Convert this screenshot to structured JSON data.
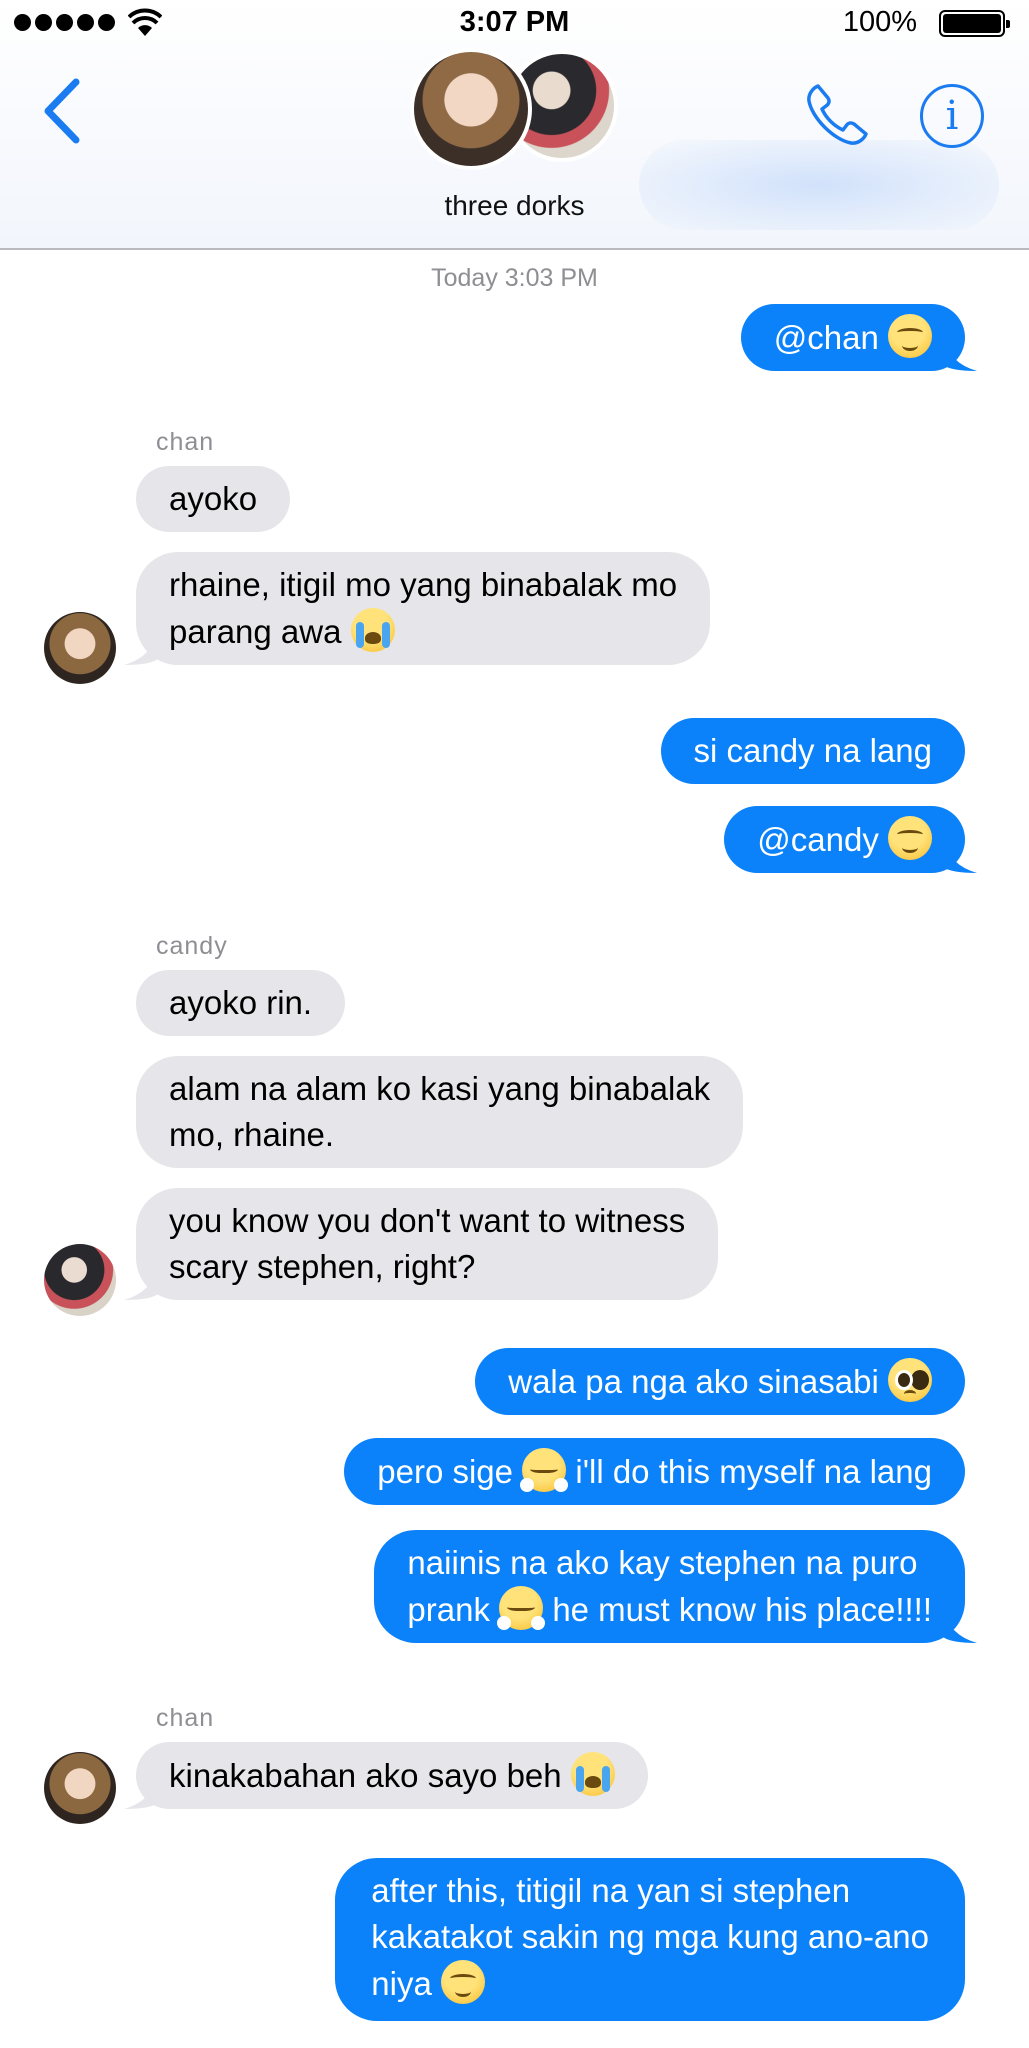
{
  "status_bar": {
    "time": "3:07 PM",
    "battery_percent": "100%",
    "signal_bars": 5,
    "wifi_icon": "wifi-icon",
    "battery_icon": "battery-icon"
  },
  "header": {
    "group_name": "three dorks",
    "back_icon": "chevron-left-icon",
    "call_icon": "phone-icon",
    "info_icon": "info-icon",
    "info_glyph": "i",
    "accent_color": "#1a7cf0"
  },
  "colors": {
    "outgoing_bubble": "#0b82fa",
    "incoming_bubble": "#e6e5ea",
    "meta_text": "#8e8e93"
  },
  "conversation": {
    "timestamp": "Today 3:03 PM",
    "messages": [
      {
        "dir": "out",
        "text": "@chan",
        "emoji": "smiling-face-emoji"
      },
      {
        "dir": "in",
        "sender": "chan",
        "text": "ayoko"
      },
      {
        "dir": "in",
        "sender": "chan",
        "line1": "rhaine, itigil mo yang binabalak mo",
        "line2": "parang awa",
        "emoji": "crying-face-emoji"
      },
      {
        "dir": "out",
        "text": "si candy na lang"
      },
      {
        "dir": "out",
        "text": "@candy",
        "emoji": "smiling-face-emoji"
      },
      {
        "dir": "in",
        "sender": "candy",
        "text": "ayoko rin."
      },
      {
        "dir": "in",
        "sender": "candy",
        "line1": "alam na alam ko kasi yang binabalak",
        "line2": "mo, rhaine."
      },
      {
        "dir": "in",
        "sender": "candy",
        "line1": "you know you don't want to witness",
        "line2": "scary stephen, right?"
      },
      {
        "dir": "out",
        "text": "wala pa nga ako sinasabi",
        "emoji": "pleading-face-emoji"
      },
      {
        "dir": "out",
        "text_before": "pero sige",
        "text_after": "i'll do this myself na lang",
        "emoji": "huffing-face-emoji"
      },
      {
        "dir": "out",
        "line1": "naiinis na ako kay stephen na puro",
        "line2_before": "prank",
        "line2_after": "he must know his place!!!!",
        "emoji": "huffing-face-emoji"
      },
      {
        "dir": "in",
        "sender": "chan",
        "text": "kinakabahan ako sayo beh",
        "emoji": "crying-face-emoji"
      },
      {
        "dir": "out",
        "line1": "after this, titigil na yan si stephen",
        "line2": "kakatakot sakin ng mga kung ano-ano",
        "line3": "niya",
        "emoji": "smiling-face-emoji"
      }
    ]
  }
}
